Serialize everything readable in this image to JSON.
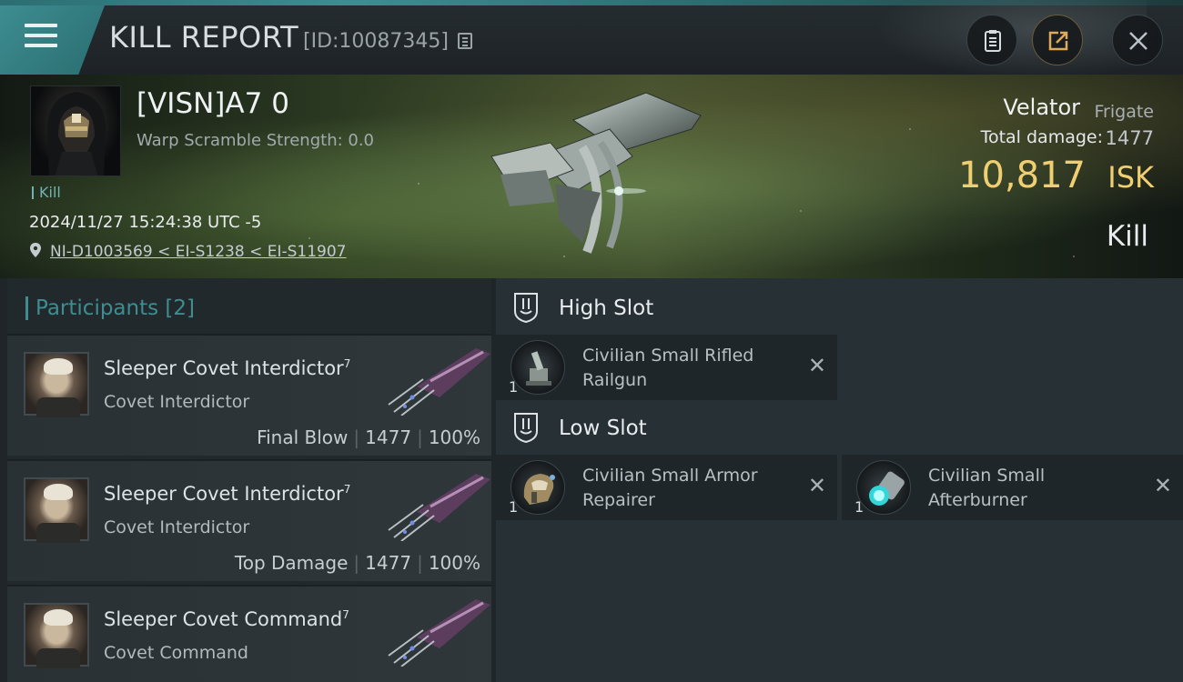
{
  "header": {
    "title": "KILL REPORT",
    "report_id": "[ID:10087345]",
    "menu_icon": "hamburger-icon",
    "buttons": [
      "clipboard-icon",
      "share-icon",
      "close-icon"
    ]
  },
  "victim": {
    "name": "[VISN]A7 0",
    "warp_scramble": "Warp Scramble Strength: 0.0",
    "tag": "Kill",
    "datetime": "2024/11/27 15:24:38 UTC -5",
    "location": "NI-D1003569 < EI-S1238 < EI-S11907",
    "ship_name": "Velator",
    "ship_class": "Frigate",
    "total_damage_label": "Total damage:",
    "total_damage": "1477",
    "isk_value": "10,817",
    "isk_unit": "ISK",
    "result": "Kill"
  },
  "participants": {
    "label": "Participants",
    "count": "[2]",
    "items": [
      {
        "name": "Sleeper Covet Interdictor",
        "level": "7",
        "ship": "Covet Interdictor",
        "role": "Final Blow",
        "damage": "1477",
        "percent": "100%"
      },
      {
        "name": "Sleeper Covet Interdictor",
        "level": "7",
        "ship": "Covet Interdictor",
        "role": "Top Damage",
        "damage": "1477",
        "percent": "100%"
      },
      {
        "name": "Sleeper Covet Command",
        "level": "7",
        "ship": "Covet Command",
        "role": "",
        "damage": "",
        "percent": ""
      }
    ]
  },
  "fitting": {
    "high_slot": {
      "title": "High Slot",
      "modules": [
        {
          "line1": "Civilian Small Rifled",
          "line2": "Railgun",
          "qty": "1"
        }
      ]
    },
    "low_slot": {
      "title": "Low Slot",
      "modules": [
        {
          "line1": "Civilian Small Armor",
          "line2": "Repairer",
          "qty": "1"
        },
        {
          "line1": "Civilian Small",
          "line2": "Afterburner",
          "qty": "1"
        }
      ]
    },
    "destroyed_mark": "✕"
  },
  "colors": {
    "accent": "#3f8d90",
    "isk": "#f0cf73",
    "tag": "#6fb4b2"
  }
}
